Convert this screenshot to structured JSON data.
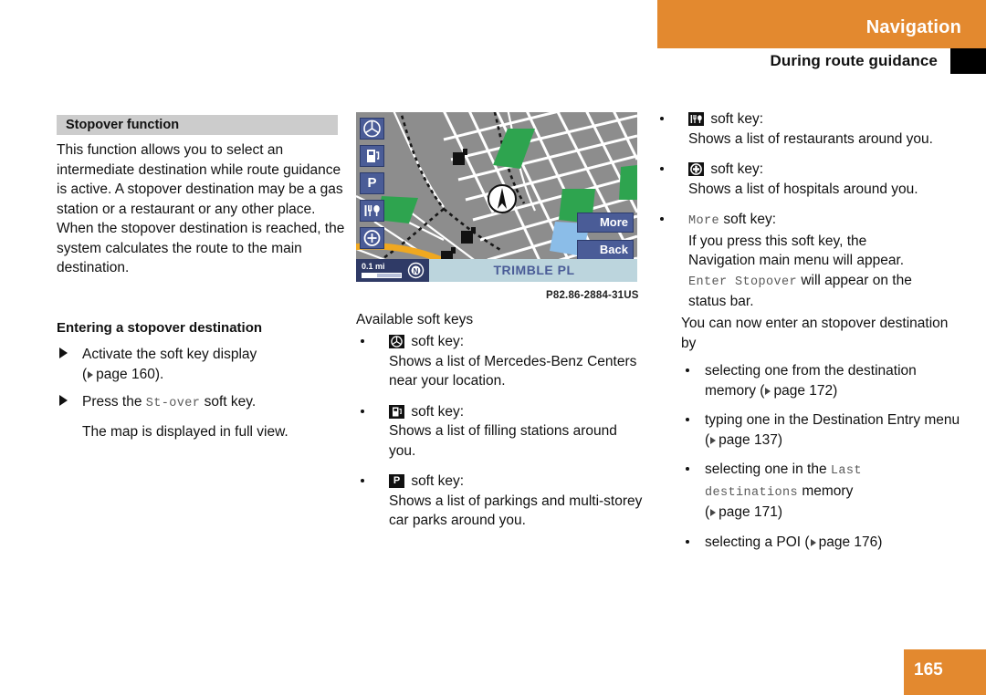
{
  "header": {
    "title": "Navigation",
    "subtitle": "During route guidance"
  },
  "page_number": "165",
  "left": {
    "section_title": "Stopover function",
    "intro": "This function allows you to select an intermediate destination while route guidance is active. A stopover destination may be a gas station or a restaurant or any other place. When the stopover destination is reached, the system calculates the route to the main destination.",
    "subhead": "Entering a stopover destination",
    "step1_a": "Activate the soft key display",
    "step1_b_open": "(",
    "step1_b_page": "page 160).",
    "step2_a": "Press the",
    "step2_key": "St-over",
    "step2_b": "soft key.",
    "step2_note": "The map is displayed in full view."
  },
  "map": {
    "softkeys": [
      {
        "name": "mercedes-star",
        "label": ""
      },
      {
        "name": "fuel-pump",
        "label": ""
      },
      {
        "name": "parking",
        "label": "P"
      },
      {
        "name": "restaurant",
        "label": ""
      },
      {
        "name": "zoom-in",
        "label": ""
      }
    ],
    "more_label": "More",
    "back_label": "Back",
    "scale": "0.1 mi",
    "street": "TRIMBLE PL",
    "caption": "P82.86-2884-31US"
  },
  "middle": {
    "avail_title": "Available soft keys",
    "items": [
      {
        "icon": "mercedes-star-icon",
        "key_suffix": "soft key:",
        "text": "Shows a list of Mercedes-Benz Centers near your location."
      },
      {
        "icon": "fuel-pump-icon",
        "key_suffix": "soft key:",
        "text": "Shows a list of filling stations around you."
      },
      {
        "icon": "parking-icon",
        "key_suffix": "soft key:",
        "text": "Shows a list of parkings and multi-storey car parks around you."
      }
    ]
  },
  "right": {
    "items": [
      {
        "icon": "restaurant-icon",
        "key_suffix": "soft key:",
        "text": "Shows a list of restaurants around you."
      },
      {
        "icon": "hospital-icon",
        "key_suffix": "soft key:",
        "text": "Shows a list of hospitals around you."
      }
    ],
    "more_item": {
      "key": "More",
      "key_suffix": "soft key:",
      "line1": "If you press this soft key, the",
      "line2": "Navigation main menu will appear.",
      "key2": "Enter Stopover",
      "line3": "will appear on the",
      "line4": "status bar."
    },
    "para": "You can now enter an stopover destination by",
    "bullets": [
      {
        "pre": "selecting one from the destination memory (",
        "mono": "",
        "post": "page 172)"
      },
      {
        "pre": "typing one in the Destination Entry menu (",
        "mono": "",
        "post": "page 137)"
      },
      {
        "pre": "selecting one in the ",
        "mono": "Last destinations",
        "post": " memory",
        "ref": "page 171)"
      },
      {
        "pre": "selecting a POI (",
        "mono": "",
        "post": "page 176)"
      }
    ]
  }
}
